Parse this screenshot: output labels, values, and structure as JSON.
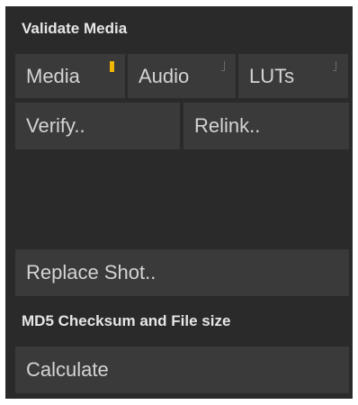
{
  "validate_media": {
    "title": "Validate Media",
    "tabs": [
      {
        "label": "Media",
        "flag": "on"
      },
      {
        "label": "Audio",
        "flag": "off"
      },
      {
        "label": "LUTs",
        "flag": "off"
      }
    ],
    "verify_label": "Verify..",
    "relink_label": "Relink.."
  },
  "replace_shot_label": "Replace Shot..",
  "checksum": {
    "title": "MD5 Checksum and File size",
    "calculate_label": "Calculate"
  },
  "colors": {
    "panel": "#2a2a2a",
    "button": "#3a3a3a",
    "text": "#d4d4d4",
    "accent_flag": "#f2b705"
  }
}
